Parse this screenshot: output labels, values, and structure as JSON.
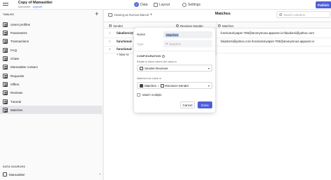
{
  "app": {
    "title": "Copy of Mamasitter",
    "owner": "Mamasitter",
    "upgrade": "Upgrade"
  },
  "nav": {
    "data": "Data",
    "layout": "Layout",
    "settings": "Settings",
    "publish": "Publish"
  },
  "sidebar": {
    "tables_header": "TABLES",
    "items": [
      {
        "label": "Users profiles"
      },
      {
        "label": "Parameters"
      },
      {
        "label": "Transactions"
      },
      {
        "label": "FAQ"
      },
      {
        "label": "Chats"
      },
      {
        "label": "Mamasitter contact"
      },
      {
        "label": "Requests"
      },
      {
        "label": "Offers"
      },
      {
        "label": "Reviews"
      },
      {
        "label": "Tutorial"
      },
      {
        "label": "Matches"
      }
    ],
    "data_sources_header": "DATA SOURCES",
    "data_source": "Mamasitter"
  },
  "main": {
    "viewing_as": "Viewing as Rozsos Marcel",
    "table_title": "Matches",
    "search_placeholder": "Search columns",
    "columns": {
      "sender": "Sender",
      "receiver_sender": "Receiver-Sender",
      "matches": "Matches"
    },
    "rows": [
      {
        "num": "1",
        "name": "faludiorsi@",
        "email": "functional-paper-783@anonymous.appuser.io-faludiorsi@yahoo.com"
      },
      {
        "num": "2",
        "name": "functional-",
        "email": "faludiorsi@yahoo.com-functional-paper-783@anonymous.appuser.io"
      },
      {
        "num": "3",
        "name": "functional-",
        "email": ""
      }
    ],
    "new_row": "+ New re"
  },
  "modal": {
    "name_label": "Name",
    "name_value": "Matches",
    "type_label": "Type",
    "type_value": "Matches",
    "configuration": "CONFIGURATION",
    "relate_help": "Relate to items where the value in",
    "relate_value": "Sender-Receiver",
    "matches_help": "Matches the value in",
    "matches_table": "Matches",
    "matches_value": "Receiver-Sender",
    "match_multiple": "Match multiple",
    "cancel": "Cancel",
    "done": "Done"
  }
}
